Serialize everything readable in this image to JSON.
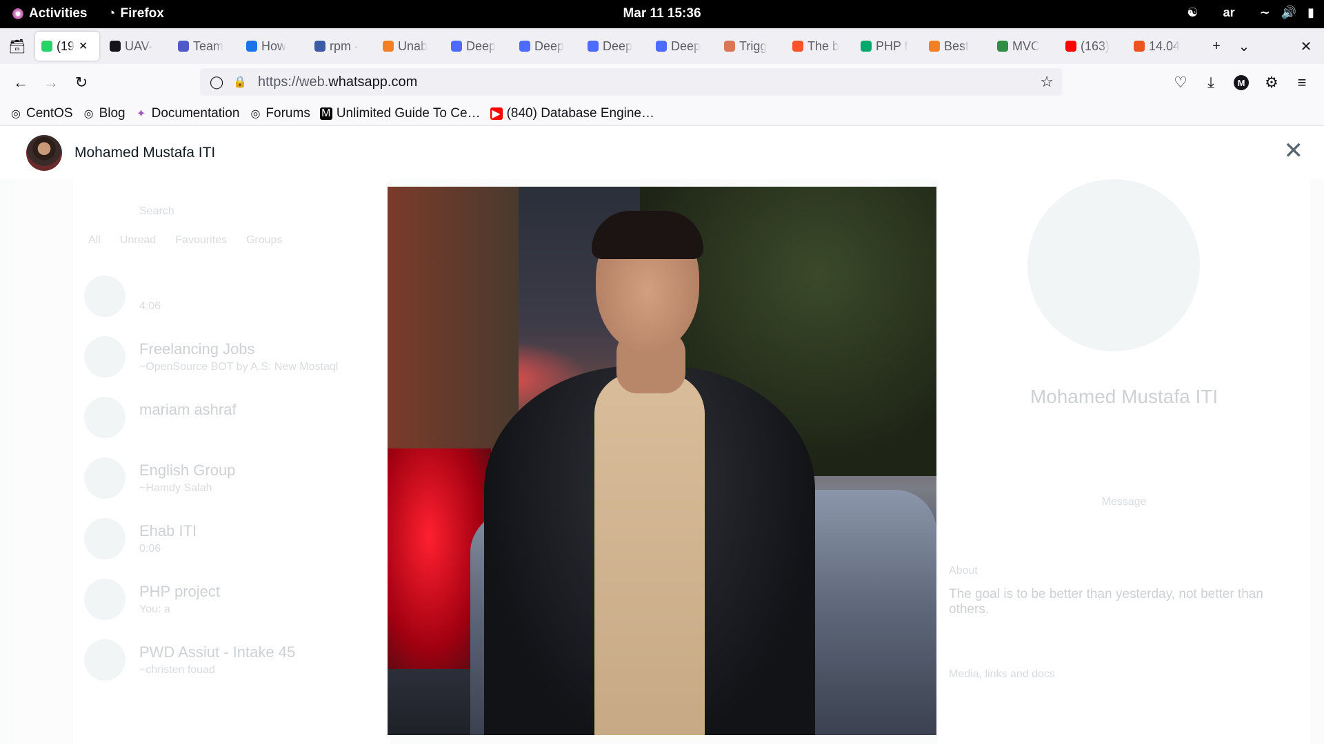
{
  "topbar": {
    "activities": "Activities",
    "app_name": "Firefox",
    "clock": "Mar 11  15:36",
    "input_method": "ar"
  },
  "tabs": [
    {
      "label": "(19",
      "favicon": "whatsapp",
      "color": "#25d366",
      "active": true
    },
    {
      "label": "UAV-",
      "favicon": "github",
      "color": "#15141a"
    },
    {
      "label": "Team",
      "favicon": "teams",
      "color": "#5059c9"
    },
    {
      "label": "How",
      "favicon": "sync",
      "color": "#1a73e8"
    },
    {
      "label": "rpm -",
      "favicon": "unix",
      "color": "#3b5ba5"
    },
    {
      "label": "Unab",
      "favicon": "stackoverflow",
      "color": "#f48024"
    },
    {
      "label": "Deep",
      "favicon": "deepseek",
      "color": "#4d6bfe"
    },
    {
      "label": "Deep",
      "favicon": "deepseek",
      "color": "#4d6bfe"
    },
    {
      "label": "Deep",
      "favicon": "deepseek",
      "color": "#4d6bfe"
    },
    {
      "label": "Deep",
      "favicon": "deepseek",
      "color": "#4d6bfe"
    },
    {
      "label": "Trigg",
      "favicon": "claude",
      "color": "#d97757"
    },
    {
      "label": "The b",
      "favicon": "brave",
      "color": "#fb542b"
    },
    {
      "label": "PHP f",
      "favicon": "w3",
      "color": "#04aa6d"
    },
    {
      "label": "Best",
      "favicon": "stackoverflow",
      "color": "#f48024"
    },
    {
      "label": "MVC",
      "favicon": "geeks",
      "color": "#2f8d46"
    },
    {
      "label": "(163)",
      "favicon": "youtube",
      "color": "#ff0000"
    },
    {
      "label": "14.04",
      "favicon": "askubuntu",
      "color": "#e95420"
    }
  ],
  "navbar": {
    "url_prefix": "https://web.",
    "url_domain": "whatsapp.com",
    "account_initial": "M"
  },
  "bookmarks": [
    {
      "label": "CentOS",
      "icon": "globe-icon"
    },
    {
      "label": "Blog",
      "icon": "globe-icon"
    },
    {
      "label": "Documentation",
      "icon": "puzzle-icon"
    },
    {
      "label": "Forums",
      "icon": "globe-icon"
    },
    {
      "label": "Unlimited Guide To Ce…",
      "icon": "medium-icon"
    },
    {
      "label": "(840) Database Engine…",
      "icon": "youtube-icon"
    }
  ],
  "viewer": {
    "contact_name": "Mohamed Mustafa ITI"
  },
  "background": {
    "search_placeholder": "Search",
    "filters": [
      "All",
      "Unread",
      "Favourites",
      "Groups"
    ],
    "chats": [
      {
        "title": "",
        "sub": "4:06"
      },
      {
        "title": "Freelancing Jobs",
        "sub": "~OpenSource BOT by A.S: New Mostaql"
      },
      {
        "title": "mariam ashraf",
        "sub": ""
      },
      {
        "title": "English Group",
        "sub": "~Hamdy Salah"
      },
      {
        "title": "Ehab ITI",
        "sub": "0:06"
      },
      {
        "title": "PHP project",
        "sub": "You: a"
      },
      {
        "title": "PWD Assiut - Intake 45",
        "sub": "~christen fouad"
      }
    ],
    "info_name": "Mohamed Mustafa ITI",
    "info_message_label": "Message",
    "about_label": "About",
    "about_text": "The goal is to be better than yesterday, not better than others.",
    "media_label": "Media, links and docs"
  }
}
